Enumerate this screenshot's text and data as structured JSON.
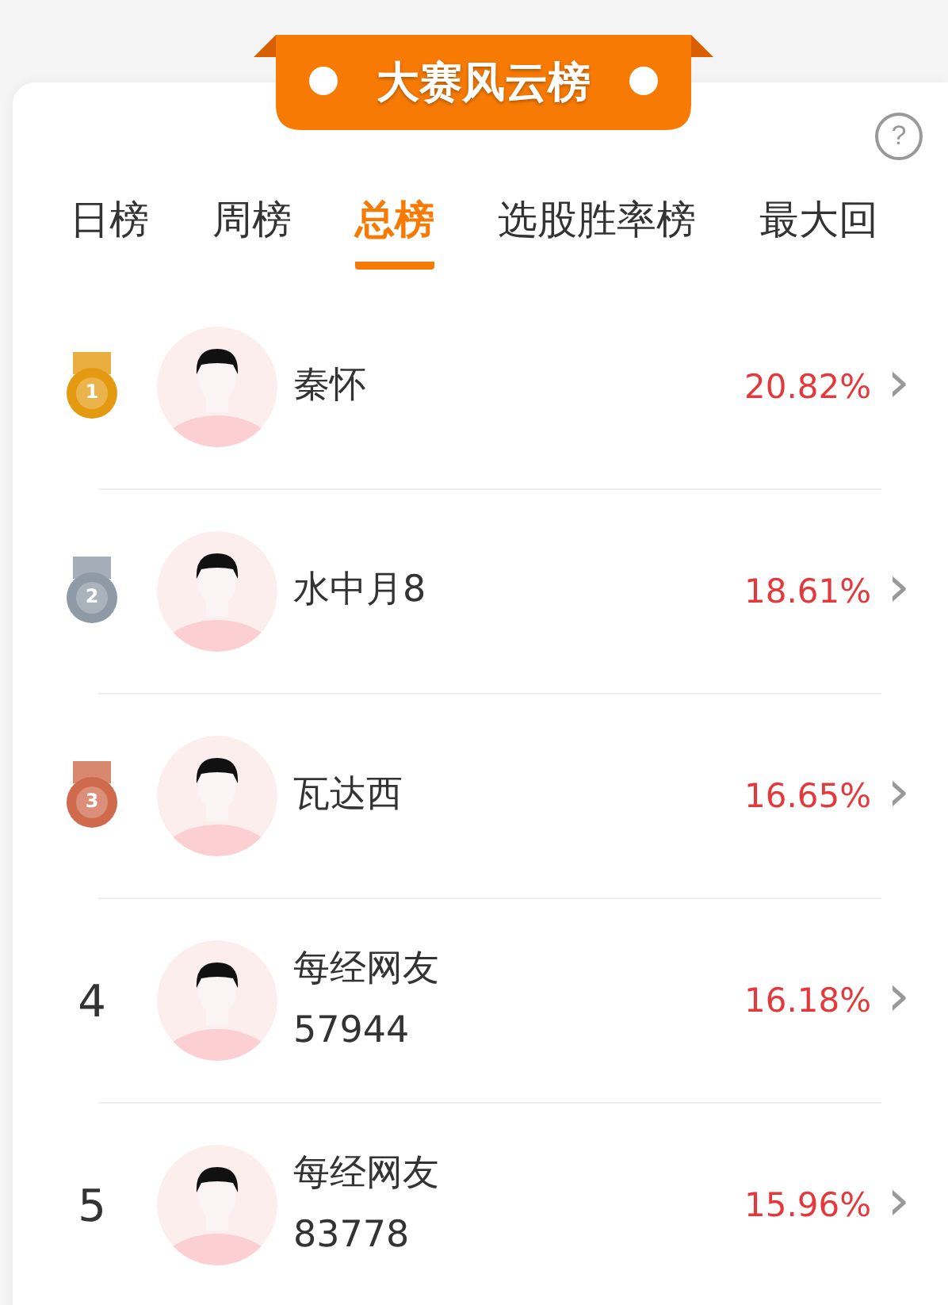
{
  "banner": {
    "title": "大赛风云榜"
  },
  "help": {
    "label": "?"
  },
  "tabs": [
    {
      "label": "日榜",
      "selected": false
    },
    {
      "label": "周榜",
      "selected": false
    },
    {
      "label": "总榜",
      "selected": true
    },
    {
      "label": "选股胜率榜",
      "selected": false
    },
    {
      "label": "最大回",
      "selected": false
    }
  ],
  "rows": [
    {
      "kind": "medal",
      "rank": "1",
      "color": "#e39a10",
      "name": "秦怀",
      "rate": "20.82%",
      "chevron": "›"
    },
    {
      "kind": "medal",
      "rank": "2",
      "color": "#8e9aa6",
      "name": "水中月8",
      "rate": "18.61%",
      "chevron": "›"
    },
    {
      "kind": "medal",
      "rank": "3",
      "color": "#cf6a4c",
      "name": "瓦达西",
      "rate": "16.65%",
      "chevron": "›"
    },
    {
      "kind": "number",
      "rank": "4",
      "name": "每经网友\n57944",
      "rate": "16.18%",
      "chevron": "›"
    },
    {
      "kind": "number",
      "rank": "5",
      "name": "每经网友\n83778",
      "rate": "15.96%",
      "chevron": "›"
    }
  ]
}
